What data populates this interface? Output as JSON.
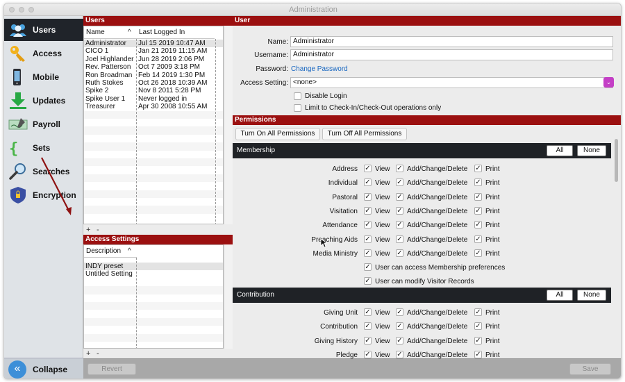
{
  "window": {
    "title": "Administration"
  },
  "sidebar": {
    "items": [
      {
        "label": "Users",
        "icon": "users-icon",
        "active": true
      },
      {
        "label": "Access",
        "icon": "key-icon"
      },
      {
        "label": "Mobile",
        "icon": "phone-icon"
      },
      {
        "label": "Updates",
        "icon": "download-icon"
      },
      {
        "label": "Payroll",
        "icon": "check-icon"
      },
      {
        "label": "Sets",
        "icon": "braces-icon"
      },
      {
        "label": "Searches",
        "icon": "magnifier-icon"
      },
      {
        "label": "Encryption",
        "icon": "shield-icon"
      }
    ],
    "collapse_label": "Collapse",
    "collapse_glyph": "«"
  },
  "users_panel": {
    "header": "Users",
    "col_name": "Name",
    "col_sort": "^",
    "col_last": "Last Logged In",
    "rows": [
      [
        "Administrator",
        "Jul 15 2019 10:47 AM"
      ],
      [
        "CICO 1",
        "Jan 21 2019 11:15 AM"
      ],
      [
        "Joel Highlander",
        "Jun 28 2019 2:06 PM"
      ],
      [
        "Rev. Patterson",
        "Oct 7 2009 3:18 PM"
      ],
      [
        "Ron Broadman",
        "Feb 14 2019 1:30 PM"
      ],
      [
        "Ruth Stokes",
        "Oct 26 2018 10:39 AM"
      ],
      [
        "Spike 2",
        "Nov 8 2011 5:28 PM"
      ],
      [
        "Spike User 1",
        "Never logged in"
      ],
      [
        "Treasurer",
        "Apr 30 2008 10:55 AM"
      ]
    ],
    "plus": "+",
    "minus": "-"
  },
  "access_settings": {
    "header": "Access Settings",
    "col_desc": "Description",
    "col_sort": "^",
    "rows": [
      "INDY preset",
      "Untitled Setting"
    ],
    "plus": "+",
    "minus": "-"
  },
  "user_form": {
    "header": "User",
    "name_label": "Name:",
    "name_value": "Administrator",
    "username_label": "Username:",
    "username_value": "Administrator",
    "password_label": "Password:",
    "change_password": "Change Password",
    "access_label": "Access Setting:",
    "access_value": "<none>",
    "disable_login": "Disable Login",
    "limit_checkin": "Limit to Check-In/Check-Out operations only"
  },
  "permissions": {
    "header": "Permissions",
    "turn_on": "Turn On All Permissions",
    "turn_off": "Turn Off All Permissions",
    "all_label": "All",
    "none_label": "None",
    "view": "View",
    "acd": "Add/Change/Delete",
    "print": "Print",
    "check": "✓",
    "membership": {
      "title": "Membership",
      "rows": [
        "Address",
        "Individual",
        "Pastoral",
        "Visitation",
        "Attendance",
        "Preaching Aids",
        "Media Ministry"
      ],
      "extra1": "User can access Membership preferences",
      "extra2": "User can modify Visitor Records"
    },
    "contribution": {
      "title": "Contribution",
      "rows": [
        "Giving Unit",
        "Contribution",
        "Giving History",
        "Pledge"
      ]
    }
  },
  "bottom": {
    "revert": "Revert",
    "save": "Save"
  }
}
